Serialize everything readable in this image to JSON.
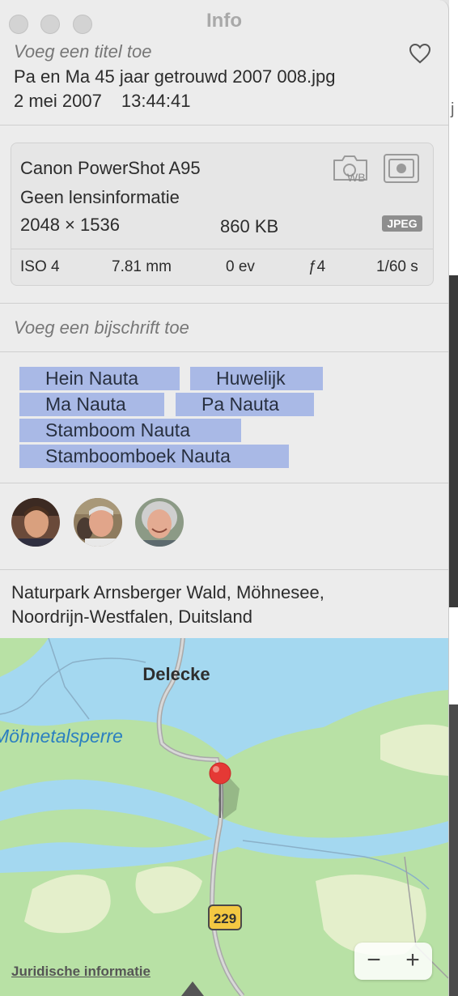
{
  "window": {
    "title": "Info"
  },
  "header": {
    "title_placeholder": "Voeg een titel toe",
    "filename": "Pa en Ma 45 jaar getrouwd 2007 008.jpg",
    "date": "2 mei 2007",
    "time": "13:44:41"
  },
  "camera": {
    "model": "Canon PowerShot A95",
    "lens": "Geen lensinformatie",
    "dimensions": "2048 × 1536",
    "size": "860 KB",
    "format": "JPEG",
    "exif": {
      "iso": "ISO 4",
      "focal": "7.81 mm",
      "ev": "0 ev",
      "aperture": "ƒ4",
      "shutter": "1/60 s"
    }
  },
  "caption": {
    "placeholder": "Voeg een bijschrift toe"
  },
  "keywords": [
    "Hein Nauta",
    "Huwelijk",
    "Ma Nauta",
    "Pa Nauta",
    "Stamboom Nauta",
    "Stamboomboek Nauta"
  ],
  "location": {
    "line1": "Naturpark Arnsberger Wald, Möhnesee,",
    "line2": "Noordrijn-Westfalen, Duitsland"
  },
  "map": {
    "label_town": "Delecke",
    "label_lake": "Möhnetalsperre",
    "road_shield": "229",
    "zoom_out": "−",
    "zoom_in": "+",
    "legal": "Juridische informatie",
    "colors": {
      "water": "#a4d8f0",
      "land": "#b8e1a5",
      "light_land": "#e4efcb",
      "pin": "#e53935"
    }
  }
}
